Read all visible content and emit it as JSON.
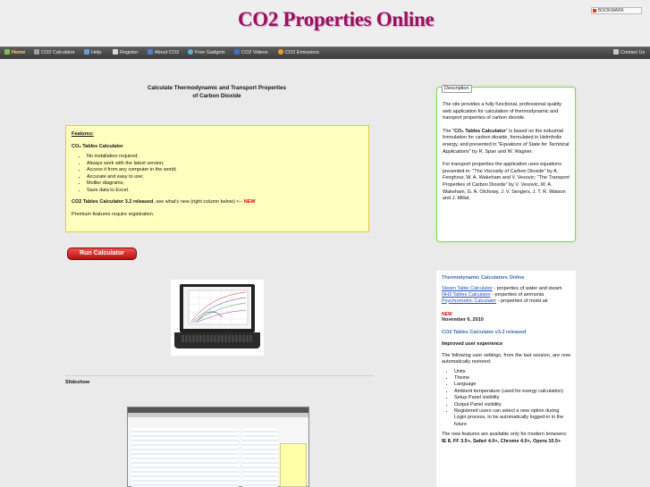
{
  "header": {
    "logo": "CO2 Properties Online",
    "bookmark_label": "BOOKMARK"
  },
  "nav": {
    "items": [
      {
        "label": "Home",
        "icon": "home-icon"
      },
      {
        "label": "CO2 Calculator",
        "icon": "calculator-icon"
      },
      {
        "label": "Help",
        "icon": "help-icon"
      },
      {
        "label": "Register",
        "icon": "register-icon"
      },
      {
        "label": "About CO2",
        "icon": "info-icon"
      },
      {
        "label": "Free Gadgets",
        "icon": "gadget-icon"
      },
      {
        "label": "CO2 Videos",
        "icon": "video-icon"
      },
      {
        "label": "CO2 Emissions",
        "icon": "emissions-icon"
      }
    ],
    "contact": {
      "label": "Contact Us",
      "icon": "mail-icon"
    }
  },
  "main": {
    "title_line1": "Calculate Thermodynamic and Transport Properties",
    "title_line2": "of Carbon Dioxide",
    "features": {
      "heading": "Features:",
      "subheading": "CO₂ Tables Calculator",
      "items": [
        "No installation required;",
        "Always work with the latest version;",
        "Access it from any computer in the world;",
        "Accurate and easy to use;",
        "Mollier diagrams;",
        "Save data to Excel."
      ],
      "release_bold": "CO2 Tables Calculator 3.2 released",
      "release_text": ", see what's new (right column below) <--",
      "release_new": "NEW",
      "premium": "Premium features require registration."
    },
    "run_button": "Run Calculator",
    "slideshow_label": "Slideshow"
  },
  "sidebar": {
    "description": {
      "label": "Description",
      "p1": "The site provides a fully functional, professional quality web application for calculation of thermodynamic and transport properties of carbon dioxide.",
      "p2_pre": "The \"",
      "p2_bold": "CO₂ Tables Calculator",
      "p2_mid": "\" is based on the industrial formulation for carbon dioxide, formulated in Helmholtz energy, and presented in \"",
      "p2_italic": "Equations of State for Technical Applications",
      "p2_post": "\" by R. Span and W. Wagner.",
      "p3": "For transport properties the application uses equations presented in: \"The Viscosity of Carbon Dioxide\" by A. Fenghour, W. A. Wakeham and V. Vesovic; \"The Transport Properties of Carbon Dioxide\" by V. Vesovic, W. A. Wakeham, G. A. Olchowy, J. V. Sengers, J. T. R. Watson and J. Millat."
    },
    "calculators": {
      "title": "Thermodynamic Calculators Online",
      "items": [
        {
          "link": "Steam Table Calculator",
          "text": " - properties of water and steam"
        },
        {
          "link": "NH3 Tables Calculator",
          "text": " - properties of ammonia"
        },
        {
          "link": "Psychrometric Calculator",
          "text": " - properties of moist air"
        }
      ]
    },
    "news": {
      "new_label": "NEW",
      "date": "November 6, 2010",
      "title": "CO2 Tables Calculator v3.2 released",
      "subtitle": "Improved user experience",
      "intro": "The following user settings, from the last session, are now automatically restored:",
      "items": [
        "Units",
        "Theme",
        "Language",
        "Ambient temperature (used for exergy calculation)",
        "Setup Panel visibility",
        "Output Panel visibility",
        "Registered users can select a new option during Login process, to be automatically logged-in in the future"
      ],
      "browsers_text": "The new features are available only for modern browsers: ",
      "browsers_bold": "IE 8, FF 3.5+, Safari 4.0+, Chrome 4.0+, Opera 10.5+"
    }
  }
}
